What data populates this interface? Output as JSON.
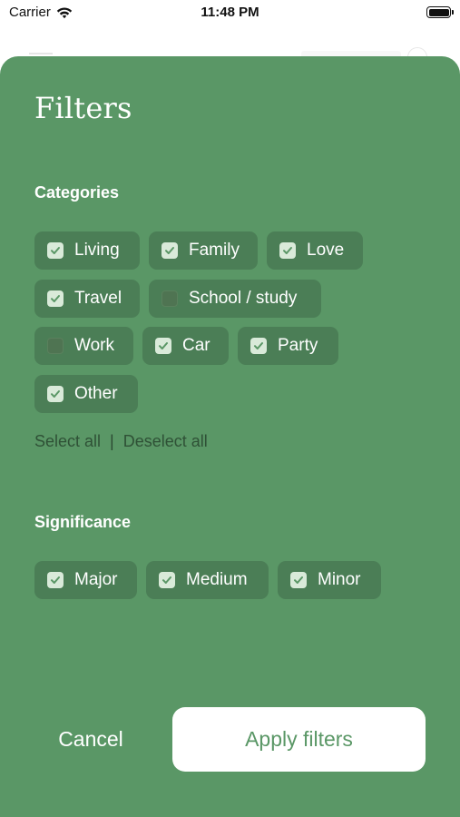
{
  "status": {
    "carrier": "Carrier",
    "time": "11:48 PM"
  },
  "filters": {
    "title": "Filters",
    "categories_heading": "Categories",
    "categories": [
      {
        "label": "Living",
        "checked": true
      },
      {
        "label": "Family",
        "checked": true
      },
      {
        "label": "Love",
        "checked": true
      },
      {
        "label": "Travel",
        "checked": true
      },
      {
        "label": "School / study",
        "checked": false
      },
      {
        "label": "Work",
        "checked": false
      },
      {
        "label": "Car",
        "checked": true
      },
      {
        "label": "Party",
        "checked": true
      },
      {
        "label": "Other",
        "checked": true
      }
    ],
    "select_all": "Select all",
    "separator": "|",
    "deselect_all": "Deselect all",
    "significance_heading": "Significance",
    "significance": [
      {
        "label": "Major",
        "checked": true
      },
      {
        "label": "Medium",
        "checked": true
      },
      {
        "label": "Minor",
        "checked": true
      }
    ],
    "cancel": "Cancel",
    "apply": "Apply filters"
  },
  "colors": {
    "sheet_bg": "#5a9766",
    "chip_bg": "#4b7e56",
    "check_bg": "#d9ead9",
    "accent": "#5a9766"
  }
}
